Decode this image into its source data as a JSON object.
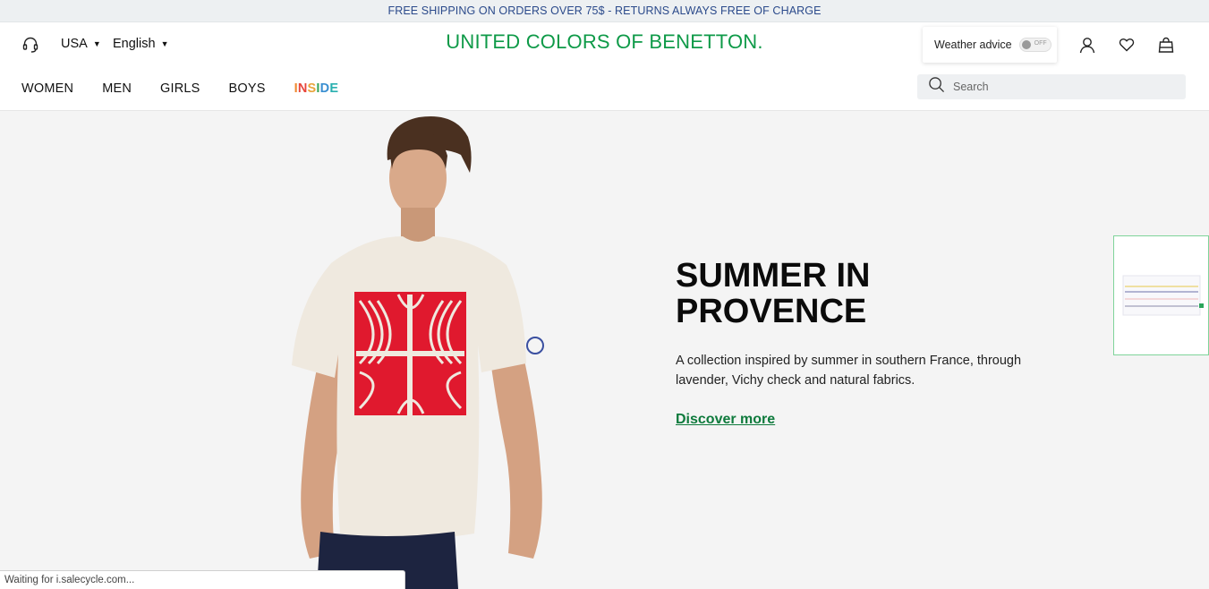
{
  "promo": {
    "text": "FREE SHIPPING ON ORDERS OVER 75$ - RETURNS ALWAYS FREE OF CHARGE"
  },
  "header": {
    "country": "USA",
    "language": "English",
    "logo": "UNITED COLORS OF BENETTON.",
    "weather": {
      "label": "Weather advice",
      "state": "OFF"
    },
    "icons": [
      "headset-icon",
      "account-icon",
      "heart-icon",
      "bag-icon",
      "search-icon"
    ]
  },
  "nav": {
    "items": [
      "WOMEN",
      "MEN",
      "GIRLS",
      "BOYS"
    ],
    "inside": [
      "I",
      "N",
      "S",
      "I",
      "D",
      "E"
    ]
  },
  "search": {
    "placeholder": "Search"
  },
  "hero": {
    "title_line1": "SUMMER IN",
    "title_line2": "PROVENCE",
    "description": "A collection inspired by summer in southern France, through lavender, Vichy check and natural fabrics.",
    "cta": "Discover more"
  },
  "status": {
    "text": "Waiting for i.salecycle.com..."
  },
  "colors": {
    "brand_green": "#0e9a48",
    "cta_green": "#0e7a3c",
    "promo_text": "#2b4a8b"
  }
}
